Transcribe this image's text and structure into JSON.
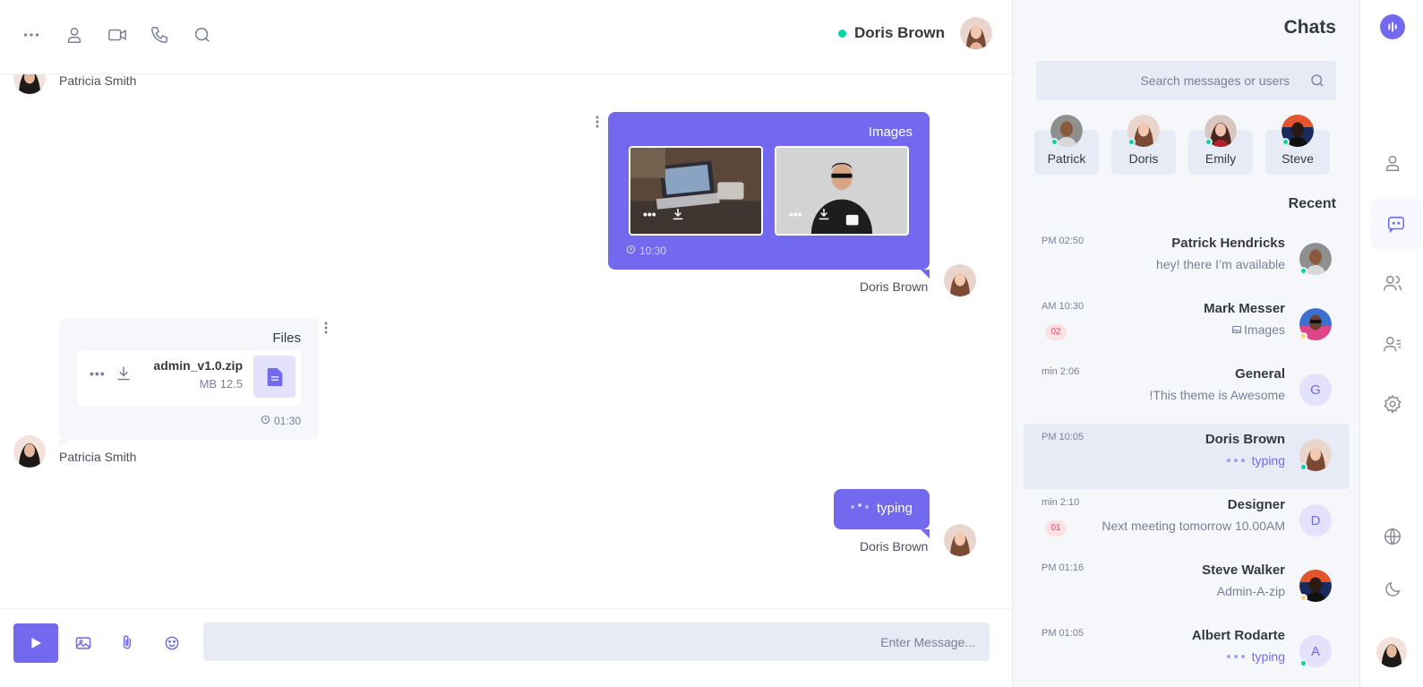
{
  "header": {
    "user_name": "Doris Brown",
    "status": "online"
  },
  "messages": {
    "patricia_name_top": "Patricia Smith",
    "images_bubble": {
      "title": "Images",
      "time": "10:30",
      "sender": "Doris Brown",
      "images": [
        {
          "alt": "laptop-on-desk"
        },
        {
          "alt": "man-with-coffee"
        }
      ]
    },
    "files_bubble": {
      "title": "Files",
      "file_name": "admin_v1.0.zip",
      "file_size": "MB 12.5",
      "time": "01:30",
      "sender": "Patricia Smith"
    },
    "typing_bubble": {
      "text": "typing",
      "sender": "Doris Brown"
    }
  },
  "input": {
    "placeholder": "...Enter Message"
  },
  "chats_panel": {
    "title": "Chats",
    "search_placeholder": "Search messages or users",
    "favorites": [
      "Patrick",
      "Doris",
      "Emily",
      "Steve"
    ],
    "recent_title": "Recent",
    "items": [
      {
        "name": "Patrick Hendricks",
        "message": "hey! there I’m available",
        "time": "PM 02:50",
        "badge": "",
        "status": "online",
        "avatar": "photo"
      },
      {
        "name": "Mark Messer",
        "message": "Images",
        "time": "AM 10:30",
        "badge": "02",
        "status": "away",
        "avatar": "photo"
      },
      {
        "name": "General",
        "message": "!This theme is Awesome",
        "time": "min 2:06",
        "badge": "",
        "status": "",
        "avatar": "G"
      },
      {
        "name": "Doris Brown",
        "message": "typing",
        "time": "PM 10:05",
        "badge": "",
        "status": "online",
        "avatar": "photo"
      },
      {
        "name": "Designer",
        "message": "Next meeting tomorrow 10.00AM",
        "time": "min 2:10",
        "badge": "01",
        "status": "",
        "avatar": "D"
      },
      {
        "name": "Steve Walker",
        "message": "Admin-A-zip",
        "time": "PM 01:16",
        "badge": "",
        "status": "away",
        "avatar": "photo"
      },
      {
        "name": "Albert Rodarte",
        "message": "typing",
        "time": "PM 01:05",
        "badge": "",
        "status": "online",
        "avatar": "A"
      }
    ]
  },
  "colors": {
    "accent": "#7269ef",
    "online": "#06d6a0",
    "away": "#ffd166",
    "badge_text": "#ef476f"
  }
}
